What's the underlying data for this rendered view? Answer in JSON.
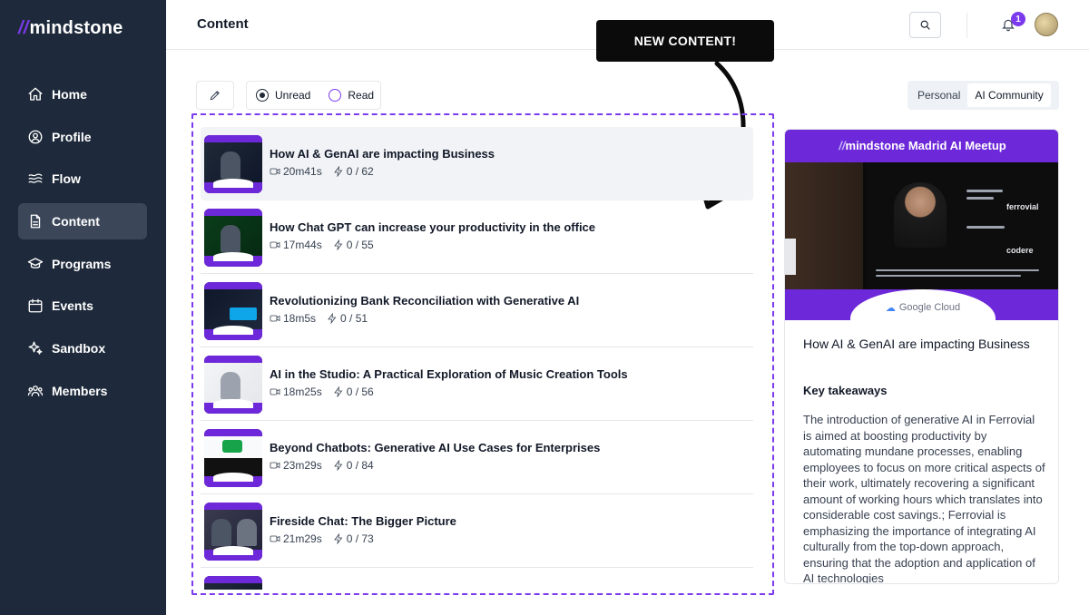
{
  "app": {
    "logo_slash": "//",
    "logo_text": "mindstone"
  },
  "sidebar": {
    "items": [
      {
        "label": "Home",
        "icon": "home-icon"
      },
      {
        "label": "Profile",
        "icon": "user-circle-icon"
      },
      {
        "label": "Flow",
        "icon": "waves-icon"
      },
      {
        "label": "Content",
        "icon": "document-icon",
        "active": true
      },
      {
        "label": "Programs",
        "icon": "graduation-cap-icon"
      },
      {
        "label": "Events",
        "icon": "calendar-icon"
      },
      {
        "label": "Sandbox",
        "icon": "sparkles-icon"
      },
      {
        "label": "Members",
        "icon": "users-icon"
      }
    ]
  },
  "header": {
    "title": "Content",
    "notification_count": "1"
  },
  "filters": {
    "unread_label": "Unread",
    "read_label": "Read",
    "selected": "Unread"
  },
  "tabs": {
    "personal": "Personal",
    "community": "AI Community",
    "active": "AI Community"
  },
  "annotation": {
    "label": "NEW CONTENT!"
  },
  "content_list": [
    {
      "title": "How AI & GenAI are impacting Business",
      "duration": "20m41s",
      "points": "0 / 62",
      "selected": true
    },
    {
      "title": "How Chat GPT can increase your productivity in the office",
      "duration": "17m44s",
      "points": "0 / 55"
    },
    {
      "title": "Revolutionizing Bank Reconciliation with Generative AI",
      "duration": "18m5s",
      "points": "0 / 51"
    },
    {
      "title": "AI in the Studio: A Practical Exploration of Music Creation Tools",
      "duration": "18m25s",
      "points": "0 / 56"
    },
    {
      "title": "Beyond Chatbots: Generative AI Use Cases for Enterprises",
      "duration": "23m29s",
      "points": "0 / 84"
    },
    {
      "title": "Fireside Chat: The Bigger Picture",
      "duration": "21m29s",
      "points": "0 / 73"
    },
    {
      "title": "",
      "duration": "",
      "points": ""
    }
  ],
  "detail": {
    "hero_slash": "//",
    "hero_title": "mindstone Madrid AI Meetup",
    "hero_sponsor": "Google Cloud",
    "hero_brands": [
      "ferrovial",
      "codere"
    ],
    "title": "How AI & GenAI are impacting Business",
    "subtitle": "Key takeaways",
    "body": "The introduction of generative AI in Ferrovial is aimed at boosting productivity by automating mundane processes, enabling employees to focus on more critical aspects of their work, ultimately recovering a significant amount of working hours which translates into considerable cost savings.; Ferrovial is emphasizing the importance of integrating AI culturally from the top-down approach, ensuring that the adoption and application of AI technologies"
  },
  "colors": {
    "sidebar_bg": "#1e2a3b",
    "accent": "#7c3aed",
    "callout_bg": "#0b0b0b"
  }
}
